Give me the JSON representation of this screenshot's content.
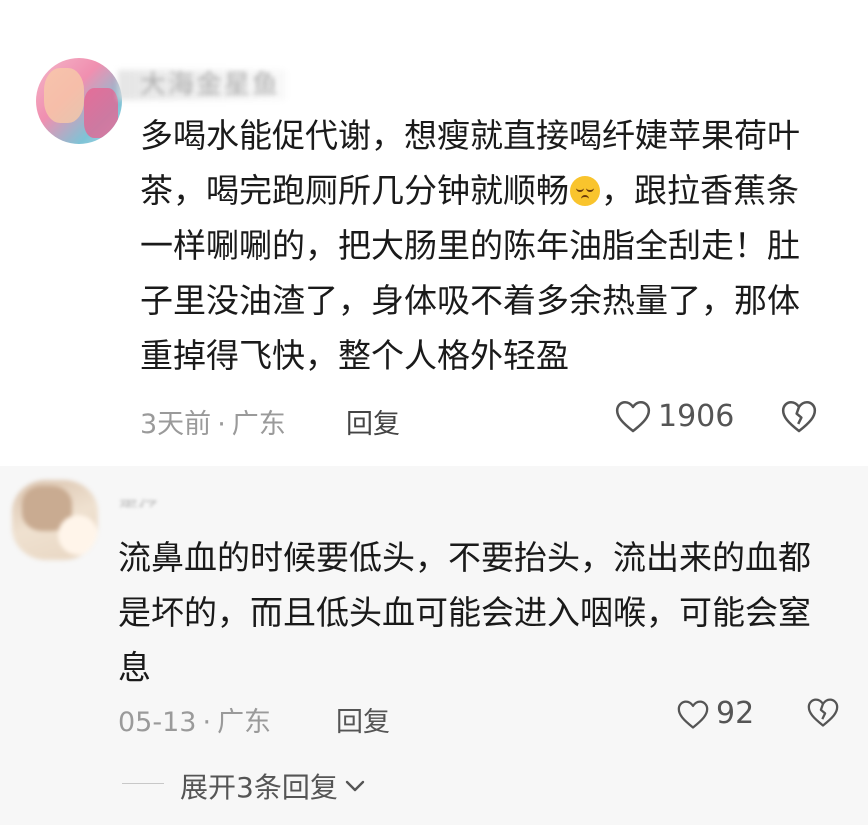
{
  "comments": [
    {
      "username": "大海金星鱼",
      "text_lines": [
        "多喝水能促代谢，想瘦就直接喝纤婕苹果荷叶",
        "茶，喝完跑厕所几分钟就顺畅",
        "，跟拉香蕉条",
        "一样唰唰的，把大肠里的陈年油脂全刮走！肚",
        "子里没油渣了，身体吸不着多余热量了，那体",
        "重掉得飞快，整个人格外轻盈"
      ],
      "emoji": "relieved-face-emoji",
      "time": "3天前",
      "separator": "·",
      "location": "广东",
      "reply_label": "回复",
      "like_count": "1906"
    },
    {
      "username": "蛋仔",
      "text_lines": [
        "流鼻血的时候要低头，不要抬头，流出来的血都",
        "是坏的，而且低头血可能会进入咽喉，可能会窒",
        "息"
      ],
      "time": "05-13",
      "separator": "·",
      "location": "广东",
      "reply_label": "回复",
      "like_count": "92"
    }
  ],
  "expand_replies_label": "展开3条回复",
  "icons": {
    "like": "heart-outline-icon",
    "dislike": "broken-heart-icon",
    "expand": "chevron-down-icon"
  },
  "colors": {
    "text": "#1a1a1a",
    "meta": "#9a9a9a",
    "panel_bottom": "#f7f7f7"
  }
}
